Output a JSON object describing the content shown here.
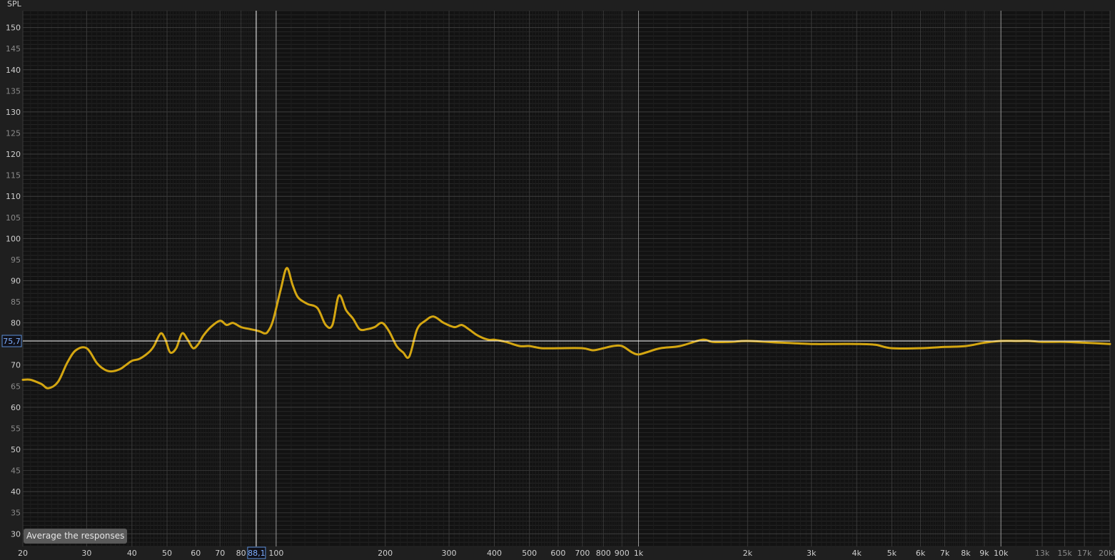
{
  "chart_data": {
    "type": "line",
    "title": "",
    "ylabel": "SPL",
    "xlabel": "",
    "x_scale": "log",
    "xlim": [
      20,
      20000
    ],
    "ylim": [
      27,
      154
    ],
    "y_ticks": [
      30,
      35,
      40,
      45,
      50,
      55,
      60,
      65,
      70,
      75,
      80,
      85,
      90,
      95,
      100,
      105,
      110,
      115,
      120,
      125,
      130,
      135,
      140,
      145,
      150
    ],
    "x_tick_labels": [
      {
        "v": 20,
        "t": "20"
      },
      {
        "v": 30,
        "t": "30"
      },
      {
        "v": 40,
        "t": "40"
      },
      {
        "v": 50,
        "t": "50"
      },
      {
        "v": 60,
        "t": "60"
      },
      {
        "v": 70,
        "t": "70"
      },
      {
        "v": 80,
        "t": "80"
      },
      {
        "v": 100,
        "t": "100"
      },
      {
        "v": 200,
        "t": "200"
      },
      {
        "v": 300,
        "t": "300"
      },
      {
        "v": 400,
        "t": "400"
      },
      {
        "v": 500,
        "t": "500"
      },
      {
        "v": 600,
        "t": "600"
      },
      {
        "v": 700,
        "t": "700"
      },
      {
        "v": 800,
        "t": "800"
      },
      {
        "v": 900,
        "t": "900"
      },
      {
        "v": 1000,
        "t": "1k"
      },
      {
        "v": 2000,
        "t": "2k"
      },
      {
        "v": 3000,
        "t": "3k"
      },
      {
        "v": 4000,
        "t": "4k"
      },
      {
        "v": 5000,
        "t": "5k"
      },
      {
        "v": 6000,
        "t": "6k"
      },
      {
        "v": 7000,
        "t": "7k"
      },
      {
        "v": 8000,
        "t": "8k"
      },
      {
        "v": 9000,
        "t": "9k"
      },
      {
        "v": 10000,
        "t": "10k"
      },
      {
        "v": 13000,
        "t": "13k"
      },
      {
        "v": 15000,
        "t": "15k"
      },
      {
        "v": 17000,
        "t": "17k"
      },
      {
        "v": 20000,
        "t": "20kHz"
      }
    ],
    "grid": true,
    "cursor": {
      "x": 88.1,
      "y": 75.7,
      "x_label": "88,1",
      "y_label": "75,7"
    },
    "series": [
      {
        "color": "#d4a611",
        "x": [
          20,
          21,
          22.5,
          23.5,
          25,
          26.5,
          28,
          30,
          32,
          33.5,
          35,
          37,
          38.5,
          40,
          42,
          44.5,
          46,
          48,
          49.5,
          51,
          53,
          55,
          57,
          59,
          61,
          63,
          66,
          70,
          73,
          76,
          80,
          85,
          90,
          93,
          95,
          98,
          103,
          107,
          111,
          115,
          122,
          130,
          137,
          143,
          149,
          156,
          163,
          170,
          178,
          187,
          196,
          205,
          215,
          224,
          233,
          245,
          258,
          272,
          290,
          310,
          325,
          340,
          360,
          385,
          400,
          430,
          470,
          500,
          540,
          600,
          700,
          750,
          800,
          850,
          900,
          960,
          1000,
          1050,
          1150,
          1300,
          1500,
          1600,
          1800,
          2000,
          2500,
          3000,
          3500,
          4000,
          4500,
          5000,
          6000,
          7000,
          8000,
          9000,
          10000,
          11000,
          12000,
          13000,
          15000,
          17000,
          20000
        ],
        "y": [
          66.5,
          66.5,
          65.5,
          64.5,
          66,
          70.5,
          73.5,
          74,
          70.5,
          69,
          68.5,
          69,
          70,
          71,
          71.5,
          73,
          74.5,
          77.5,
          76,
          73,
          74,
          77.5,
          76,
          74,
          75,
          77,
          79,
          80.5,
          79.5,
          80,
          79,
          78.5,
          78,
          77.5,
          78,
          80.5,
          88,
          93,
          89,
          86,
          84.5,
          83.5,
          79.5,
          79.5,
          86.5,
          83,
          81,
          78.5,
          78.5,
          79,
          80,
          78,
          74.5,
          73,
          72,
          78.5,
          80.5,
          81.5,
          80,
          79,
          79.5,
          78.5,
          77,
          76,
          76,
          75.5,
          74.5,
          74.5,
          74,
          74,
          74,
          73.5,
          74,
          74.5,
          74.5,
          73,
          72.5,
          73,
          74,
          74.5,
          76,
          75.5,
          75.5,
          75.7,
          75.3,
          75,
          75,
          75,
          74.8,
          74,
          74,
          74.3,
          74.5,
          75.3,
          75.7,
          75.7,
          75.7,
          75.5,
          75.5,
          75.3,
          75
        ]
      }
    ]
  },
  "avg_button_label": "Average the responses"
}
